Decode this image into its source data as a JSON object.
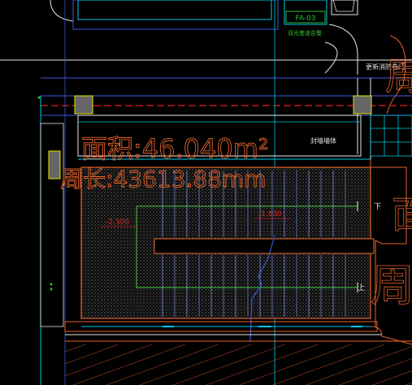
{
  "drawing": {
    "tag": "FA-03",
    "tag_caption": "双光巷道告警",
    "door_label": "更新消防卷门",
    "wall_label": "封墙墙体",
    "area_text": "面积:46.040m²",
    "perimeter_text": "周长:43613.88mm",
    "elev_left": "-2.300",
    "elev_right": "-1.650",
    "down_mark": "下",
    "up_mark": "上",
    "right_big_char_top": "周",
    "right_big_char_mid": "面",
    "right_big_char_bottom": "周"
  },
  "colors": {
    "background": "#000000",
    "cyan": "#00c8e6",
    "blue": "#3c5adc",
    "red": "#e02020",
    "orange": "#e8642a",
    "white": "#e8e8e8",
    "green": "#30c030",
    "yellow": "#e6e600",
    "hatch": "#6e6e6e"
  }
}
